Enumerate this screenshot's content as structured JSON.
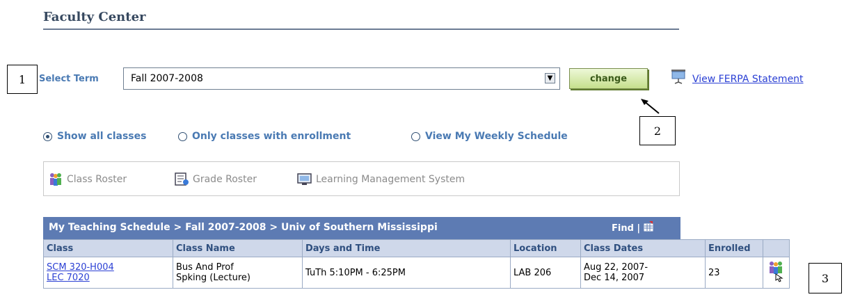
{
  "header": {
    "title": "Faculty Center"
  },
  "callouts": [
    "1",
    "2",
    "3"
  ],
  "term": {
    "label": "Select Term",
    "selected": "Fall 2007-2008",
    "change_label": "change",
    "ferpa_link": "View FERPA Statement"
  },
  "filters": {
    "show_all": "Show all classes",
    "only_enrolled": "Only classes with enrollment",
    "weekly_schedule": "View My Weekly Schedule",
    "selected": "show_all"
  },
  "legend": {
    "class_roster": "Class Roster",
    "grade_roster": "Grade Roster",
    "lms": "Learning Management System"
  },
  "schedule": {
    "title": "My Teaching Schedule > Fall 2007-2008 > Univ of Southern Mississippi",
    "find": "Find |",
    "columns": [
      "Class",
      "Class Name",
      "Days and Time",
      "Location",
      "Class Dates",
      "Enrolled"
    ],
    "rows": [
      {
        "class_line1": "SCM 320-H004",
        "class_line2": "LEC 7020",
        "name_line1": "Bus And Prof",
        "name_line2": "Spking (Lecture)",
        "days_time": "TuTh 5:10PM - 6:25PM",
        "location": "LAB 206",
        "dates_line1": "Aug 22, 2007-",
        "dates_line2": "Dec 14, 2007",
        "enrolled": "23"
      }
    ]
  },
  "colors": {
    "accent": "#5d7bb3",
    "link": "#2a3fd4",
    "label": "#4a7ab3",
    "button": "#c5df8c"
  }
}
